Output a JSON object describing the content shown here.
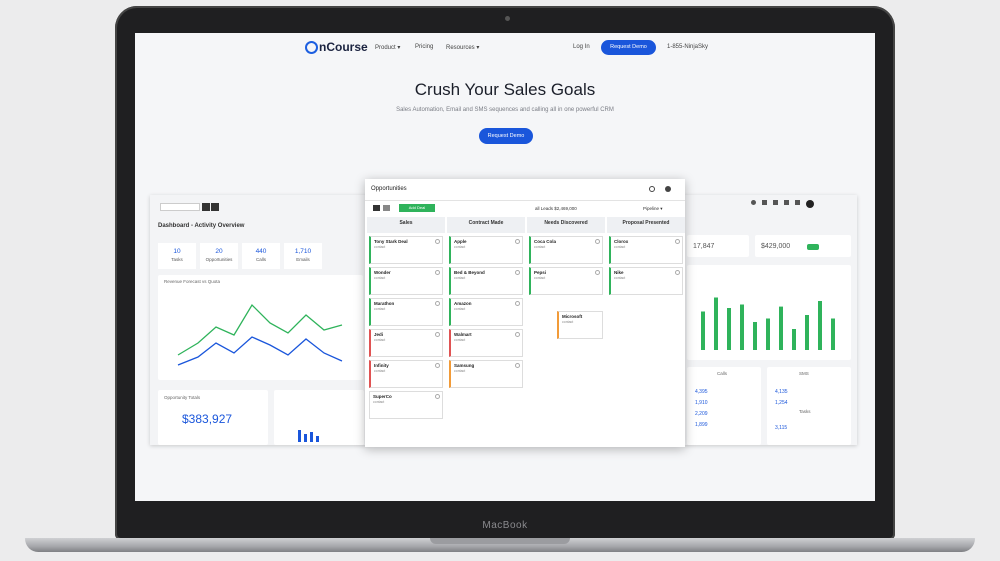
{
  "device": {
    "label": "MacBook"
  },
  "site": {
    "logo": "nCourse",
    "nav": [
      "Product ▾",
      "Pricing",
      "Resources ▾"
    ],
    "login": "Log In",
    "demo": "Request Demo",
    "phone": "1-855-NinjaSky"
  },
  "hero": {
    "title": "Crush Your Sales Goals",
    "subtitle": "Sales Automation, Email and SMS sequences and calling all in one powerful CRM",
    "cta": "Request Demo"
  },
  "dashboard": {
    "title": "Dashboard - Activity Overview",
    "kpis": [
      {
        "value": "10",
        "label": "Tasks"
      },
      {
        "value": "20",
        "label": "Opportunities"
      },
      {
        "value": "440",
        "label": "Calls"
      },
      {
        "value": "1,710",
        "label": "Emails"
      }
    ],
    "revenue_label": "Opportunity Totals",
    "revenue_value": "$383,927",
    "chart_label": "Revenue Forecast vs Quota"
  },
  "board": {
    "title": "Opportunities",
    "add_button": "Add Deal",
    "summary": "all Leads $2,469,000",
    "view": "Pipeline ▾",
    "columns": [
      {
        "name": "Sales",
        "cards": [
          "Tony Stark Deal",
          "Wonder",
          "Marathon",
          "Jedi",
          "Infinity",
          "SuperCo"
        ]
      },
      {
        "name": "Contract Made",
        "cards": [
          "Apple",
          "Bed & Beyond",
          "Amazon",
          "Walmart",
          "Samsung"
        ]
      },
      {
        "name": "Needs Discovered",
        "cards": [
          "Coca Cola",
          "Pepsi",
          "Microsoft"
        ]
      },
      {
        "name": "Proposal Presented",
        "cards": [
          "Clorox",
          "Nike"
        ]
      }
    ]
  },
  "right": {
    "metric_value": "$429,000",
    "metric_value2": "17,847",
    "bars_heights": [
      0.55,
      0.75,
      0.6,
      0.65,
      0.4,
      0.45,
      0.62,
      0.3,
      0.5,
      0.7,
      0.45
    ],
    "list_head1": "Calls",
    "list_head2": "SMS",
    "list_head3": "Tasks",
    "values": [
      "4,395",
      "1,910",
      "2,209",
      "1,899",
      "4,135",
      "1,254",
      "3,115"
    ]
  }
}
